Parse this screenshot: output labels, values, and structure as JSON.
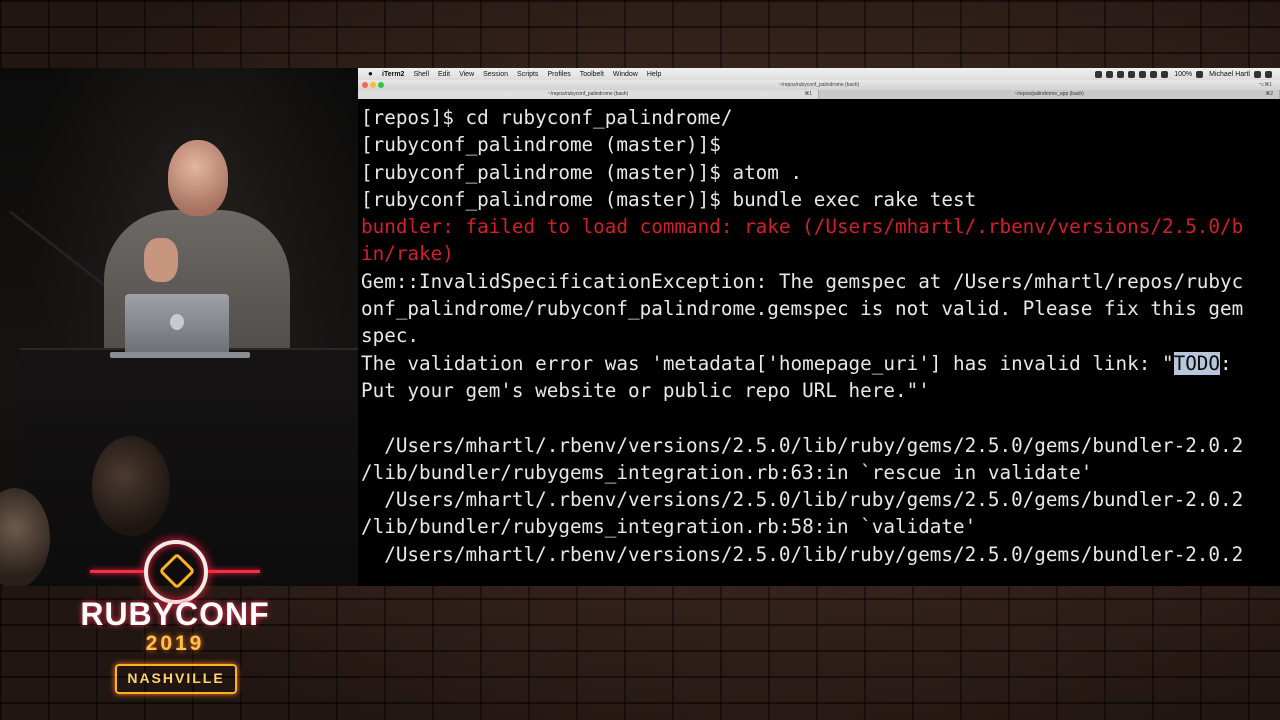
{
  "logo": {
    "title": "RUBYCONF",
    "year": "2019",
    "city": "NASHVILLE"
  },
  "menubar": {
    "app": "iTerm2",
    "items": [
      "Shell",
      "Edit",
      "View",
      "Session",
      "Scripts",
      "Profiles",
      "Toolbelt",
      "Window",
      "Help"
    ],
    "battery": "100%",
    "user": "Michael Hartl"
  },
  "titlebar": {
    "title": "~/repos/rubyconf_palindrome (bash)",
    "shortcut": "⌥⌘1"
  },
  "tabs": [
    {
      "label": "~/repos/rubyconf_palindrome (bash)",
      "key": "⌘1",
      "active": true
    },
    {
      "label": "~/repos/palindrome_app (bash)",
      "key": "⌘2",
      "active": false
    }
  ],
  "terminal": {
    "lines": [
      {
        "text": "[repos]$ cd rubyconf_palindrome/",
        "style": "normal"
      },
      {
        "text": "[rubyconf_palindrome (master)]$",
        "style": "normal"
      },
      {
        "text": "[rubyconf_palindrome (master)]$ atom .",
        "style": "normal"
      },
      {
        "text": "[rubyconf_palindrome (master)]$ bundle exec rake test",
        "style": "normal"
      },
      {
        "text": "bundler: failed to load command: rake (/Users/mhartl/.rbenv/versions/2.5.0/b",
        "style": "error"
      },
      {
        "text": "in/rake)",
        "style": "error"
      },
      {
        "text": "Gem::InvalidSpecificationException: The gemspec at /Users/mhartl/repos/rubyc",
        "style": "normal"
      },
      {
        "text": "onf_palindrome/rubyconf_palindrome.gemspec is not valid. Please fix this gem",
        "style": "normal"
      },
      {
        "text": "spec.",
        "style": "normal"
      },
      {
        "text": "The validation error was 'metadata['homepage_uri'] has invalid link: \"",
        "style": "normal",
        "highlight": "TODO",
        "after": ":"
      },
      {
        "text": "Put your gem's website or public repo URL here.\"'",
        "style": "normal"
      },
      {
        "text": "",
        "style": "normal"
      },
      {
        "text": "  /Users/mhartl/.rbenv/versions/2.5.0/lib/ruby/gems/2.5.0/gems/bundler-2.0.2",
        "style": "normal"
      },
      {
        "text": "/lib/bundler/rubygems_integration.rb:63:in `rescue in validate'",
        "style": "normal"
      },
      {
        "text": "  /Users/mhartl/.rbenv/versions/2.5.0/lib/ruby/gems/2.5.0/gems/bundler-2.0.2",
        "style": "normal"
      },
      {
        "text": "/lib/bundler/rubygems_integration.rb:58:in `validate'",
        "style": "normal"
      },
      {
        "text": "  /Users/mhartl/.rbenv/versions/2.5.0/lib/ruby/gems/2.5.0/gems/bundler-2.0.2",
        "style": "normal"
      }
    ]
  }
}
